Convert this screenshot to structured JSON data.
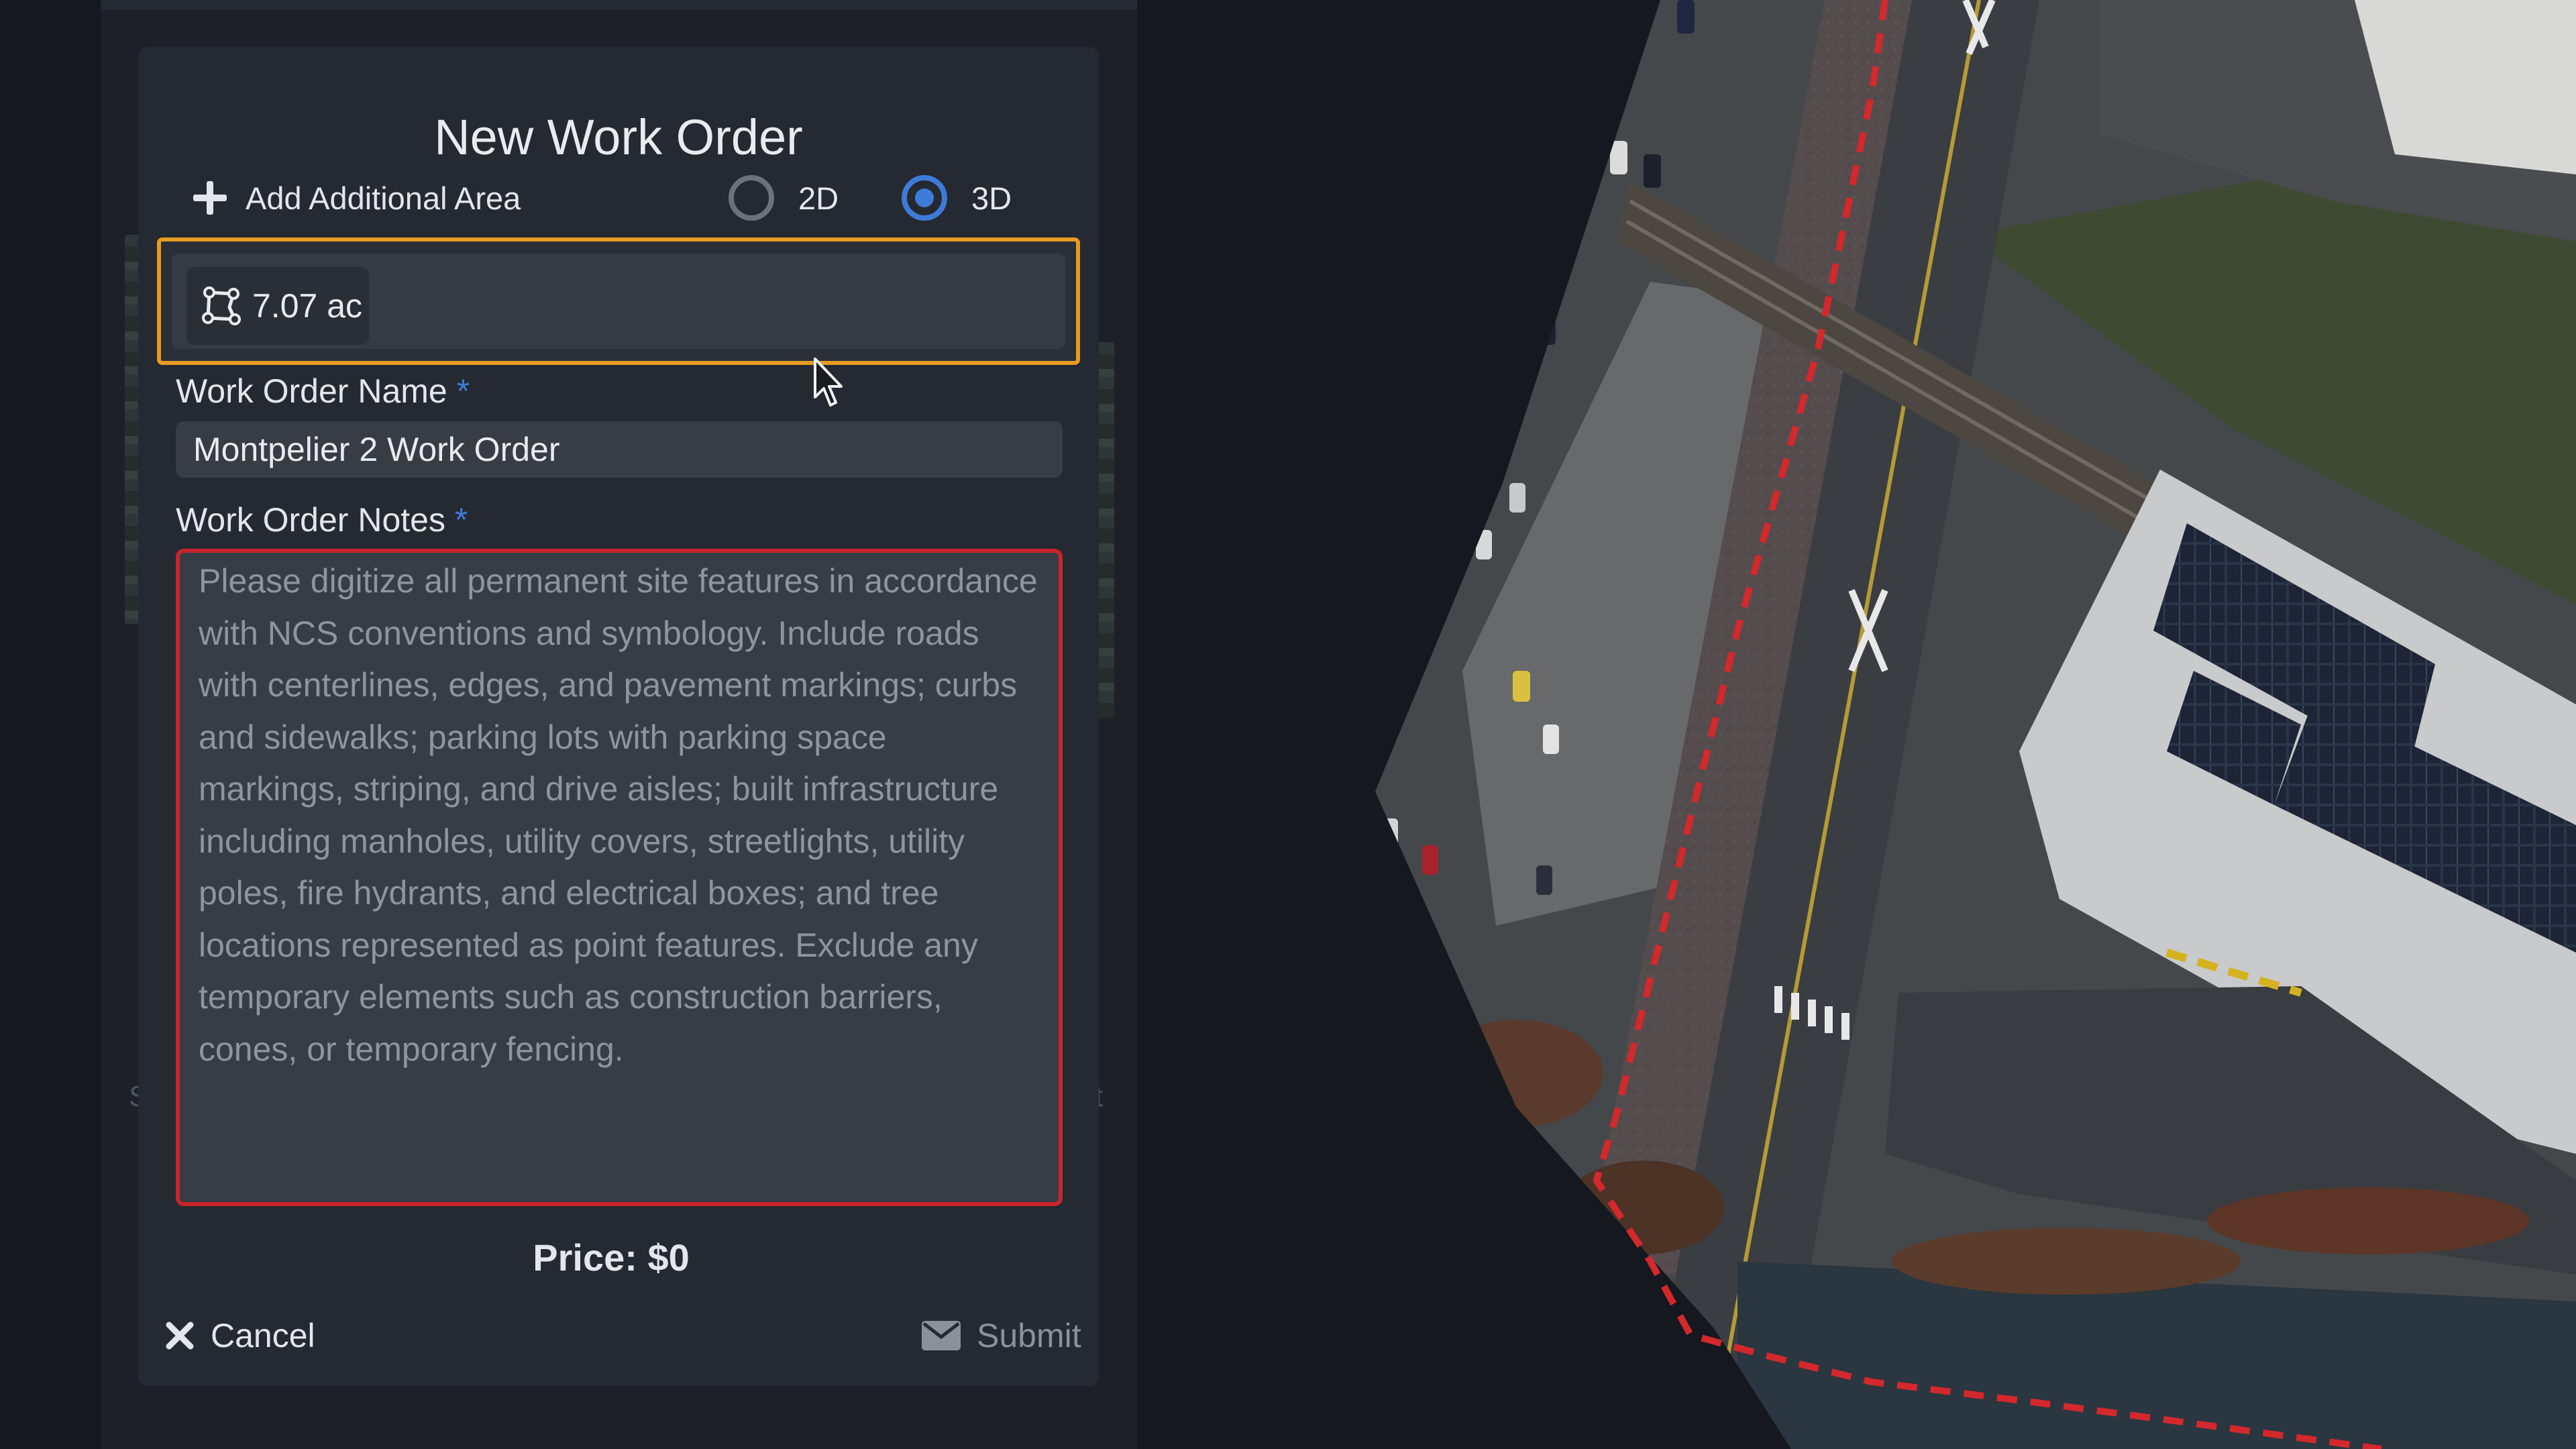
{
  "dialog": {
    "title": "New Work Order",
    "add_area_label": "Add Additional Area",
    "dimension_options": [
      {
        "label": "2D",
        "selected": false
      },
      {
        "label": "3D",
        "selected": true
      }
    ],
    "area_chip": {
      "icon": "polygon-icon",
      "value": "7.07 ac"
    },
    "name_field": {
      "label": "Work Order Name",
      "required_mark": "*",
      "value": "Montpelier 2 Work Order"
    },
    "notes_field": {
      "label": "Work Order Notes",
      "required_mark": "*",
      "value": "Please digitize all permanent site features in accordance with NCS conventions and symbology. Include roads with centerlines, edges, and pavement markings; curbs and sidewalks; parking lots with parking space markings, striping, and drive aisles; built infrastructure including manholes, utility covers, streetlights, utility poles, fire hydrants, and electrical boxes; and tree locations represented as point features. Exclude any temporary elements such as construction barriers, cones, or temporary fencing."
    },
    "price_label": "Price: $0",
    "cancel_label": "Cancel",
    "submit_label": "Submit"
  },
  "background": {
    "left_letter": "S",
    "right_letter": "t"
  },
  "colors": {
    "highlight": "#e79b22",
    "error_border": "#c8242b",
    "accent": "#3d7bd9"
  }
}
